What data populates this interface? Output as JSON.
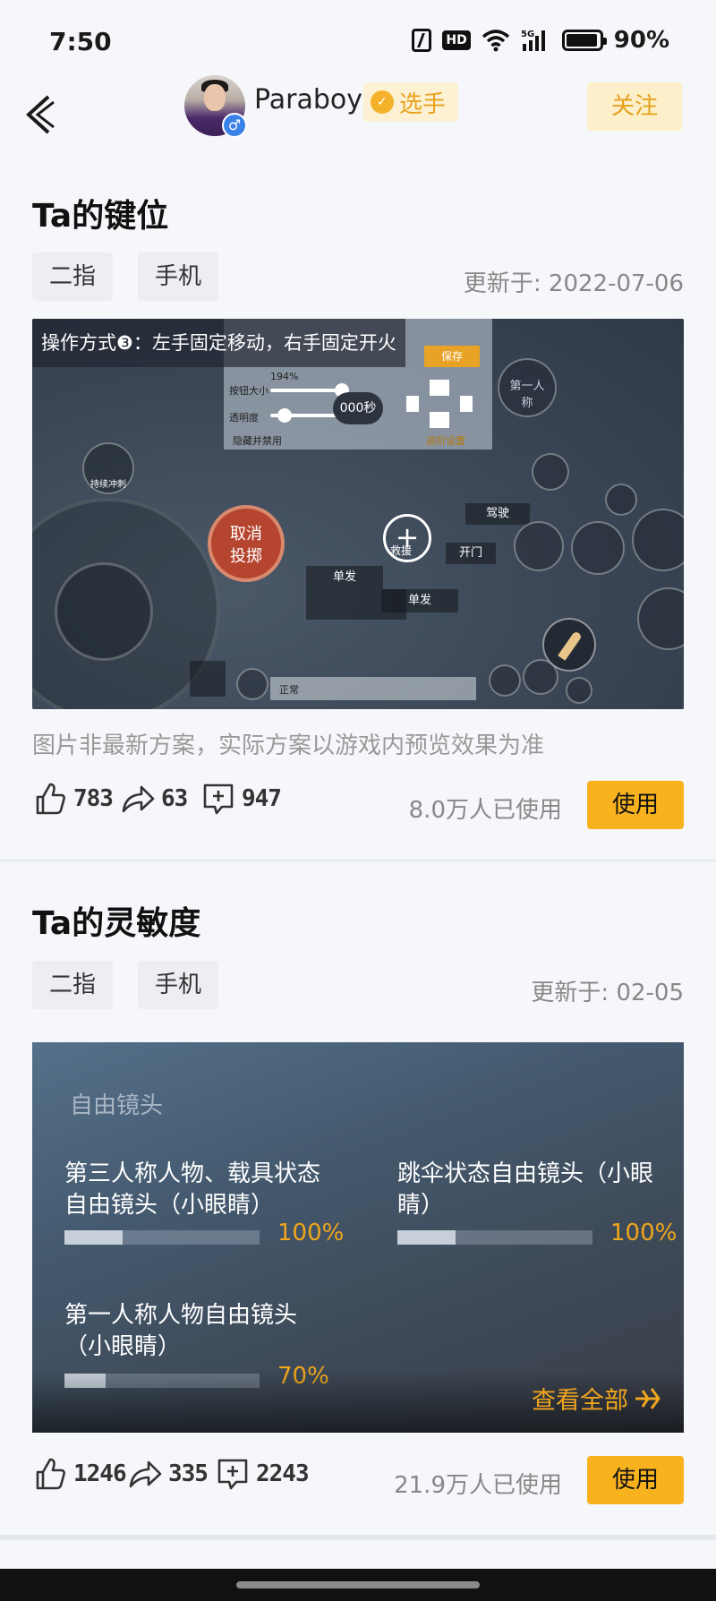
{
  "status_bar": {
    "time": "7:50",
    "battery": "90%",
    "network": "5G"
  },
  "profile": {
    "username": "Paraboy",
    "role": "选手",
    "follow_label": "关注"
  },
  "keymap": {
    "title": "Ta的键位",
    "tags": [
      "二指",
      "手机"
    ],
    "updated": "更新于: 2022-07-06",
    "operation_mode": "操作方式❸：左手固定移动，右手固定开火",
    "hint": "图片非最新方案，实际方案以游戏内预览效果为准",
    "likes": "783",
    "shares": "63",
    "saves": "947",
    "users": "8.0万人已使用",
    "use_label": "使用",
    "screenshot_labels": {
      "sprint": "持续冲刺",
      "cancel_throw": "取消\n投掷",
      "rescue": "救援",
      "drive": "驾驶",
      "open_door": "开门",
      "single": "单发",
      "save": "保存",
      "counter": "000秒",
      "first_person": "第一人称",
      "button_size": "按钮大小",
      "opacity": "透明度",
      "size_value": "194%",
      "advanced": "进阶设置",
      "hide": "隐藏并禁用",
      "normal": "正常"
    }
  },
  "sensitivity": {
    "title": "Ta的灵敏度",
    "tags": [
      "二指",
      "手机"
    ],
    "updated": "更新于: 02-05",
    "heading": "自由镜头",
    "items": [
      {
        "name": "第三人称人物、载具状态自由镜头（小眼睛）",
        "value": "100%",
        "fraction": 1.0
      },
      {
        "name": "跳伞状态自由镜头（小眼睛）",
        "value": "100%",
        "fraction": 1.0
      },
      {
        "name": "第一人称人物自由镜头（小眼睛）",
        "value": "70%",
        "fraction": 0.7
      }
    ],
    "view_all": "查看全部",
    "likes": "1246",
    "shares": "335",
    "saves": "2243",
    "users": "21.9万人已使用",
    "use_label": "使用"
  },
  "colors": {
    "accent": "#f7b21e",
    "follow_bg": "#fcefc9",
    "progress_text": "#f0a61e"
  }
}
